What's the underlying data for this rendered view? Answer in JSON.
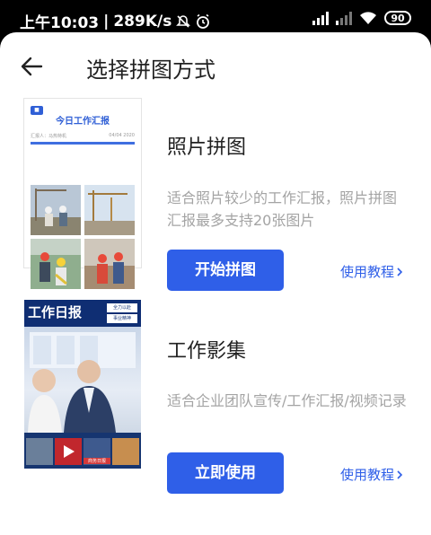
{
  "status_bar": {
    "time": "上午10:03",
    "speed": "289K/s",
    "battery": "90"
  },
  "header": {
    "title": "选择拼图方式"
  },
  "cards": [
    {
      "title": "照片拼图",
      "description": "适合照片较少的工作汇报，照片拼图汇报最多支持20张图片",
      "button_label": "开始拼图",
      "link_label": "使用教程",
      "thumb": {
        "heading": "今日工作汇报",
        "reporter": "汇报人：马热特机",
        "date": "04/04 2020"
      }
    },
    {
      "title": "工作影集",
      "description": "适合企业团队宣传/工作汇报/视频记录",
      "button_label": "立即使用",
      "link_label": "使用教程",
      "thumb": {
        "heading": "工作日报",
        "tag1": "全力以赴",
        "tag2": "事业精神",
        "strip_label": "商务日报"
      }
    }
  ],
  "colors": {
    "accent": "#2f5fe8",
    "title": "#222222",
    "muted": "#a4a4a4"
  }
}
